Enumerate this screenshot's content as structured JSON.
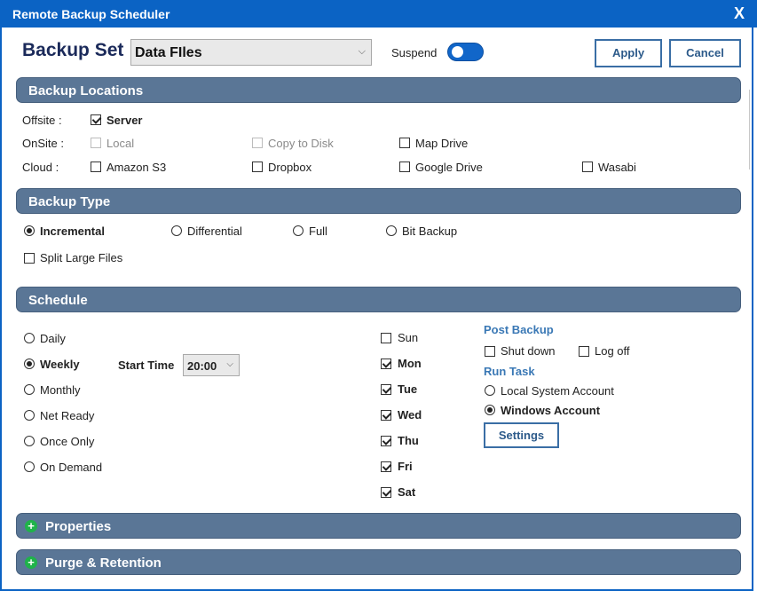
{
  "window": {
    "title": "Remote Backup Scheduler",
    "close_glyph": "X"
  },
  "header": {
    "backup_set_label": "Backup Set",
    "backup_set_value": "Data FIles",
    "suspend_label": "Suspend",
    "apply_label": "Apply",
    "cancel_label": "Cancel"
  },
  "locations": {
    "title": "Backup Locations",
    "offsite_label": "Offsite :",
    "onsite_label": "OnSite :",
    "cloud_label": "Cloud :",
    "server": "Server",
    "local": "Local",
    "copy_to_disk": "Copy to Disk",
    "map_drive": "Map Drive",
    "amazon_s3": "Amazon S3",
    "dropbox": "Dropbox",
    "google_drive": "Google Drive",
    "wasabi": "Wasabi"
  },
  "backup_type": {
    "title": "Backup Type",
    "incremental": "Incremental",
    "differential": "Differential",
    "full": "Full",
    "bit_backup": "Bit Backup",
    "split_large_files": "Split Large Files"
  },
  "schedule": {
    "title": "Schedule",
    "daily": "Daily",
    "weekly": "Weekly",
    "monthly": "Monthly",
    "net_ready": "Net Ready",
    "once_only": "Once Only",
    "on_demand": "On Demand",
    "start_time_label": "Start Time",
    "start_time_value": "20:00",
    "days": {
      "sun": "Sun",
      "mon": "Mon",
      "tue": "Tue",
      "wed": "Wed",
      "thu": "Thu",
      "fri": "Fri",
      "sat": "Sat"
    },
    "post_backup_title": "Post Backup",
    "shut_down": "Shut down",
    "log_off": "Log off",
    "run_task_title": "Run Task",
    "local_system_account": "Local System Account",
    "windows_account": "Windows Account",
    "settings_label": "Settings"
  },
  "properties": {
    "title": "Properties"
  },
  "purge": {
    "title": "Purge & Retention"
  },
  "icons": {
    "plus": "+",
    "chevron": "⌵"
  }
}
